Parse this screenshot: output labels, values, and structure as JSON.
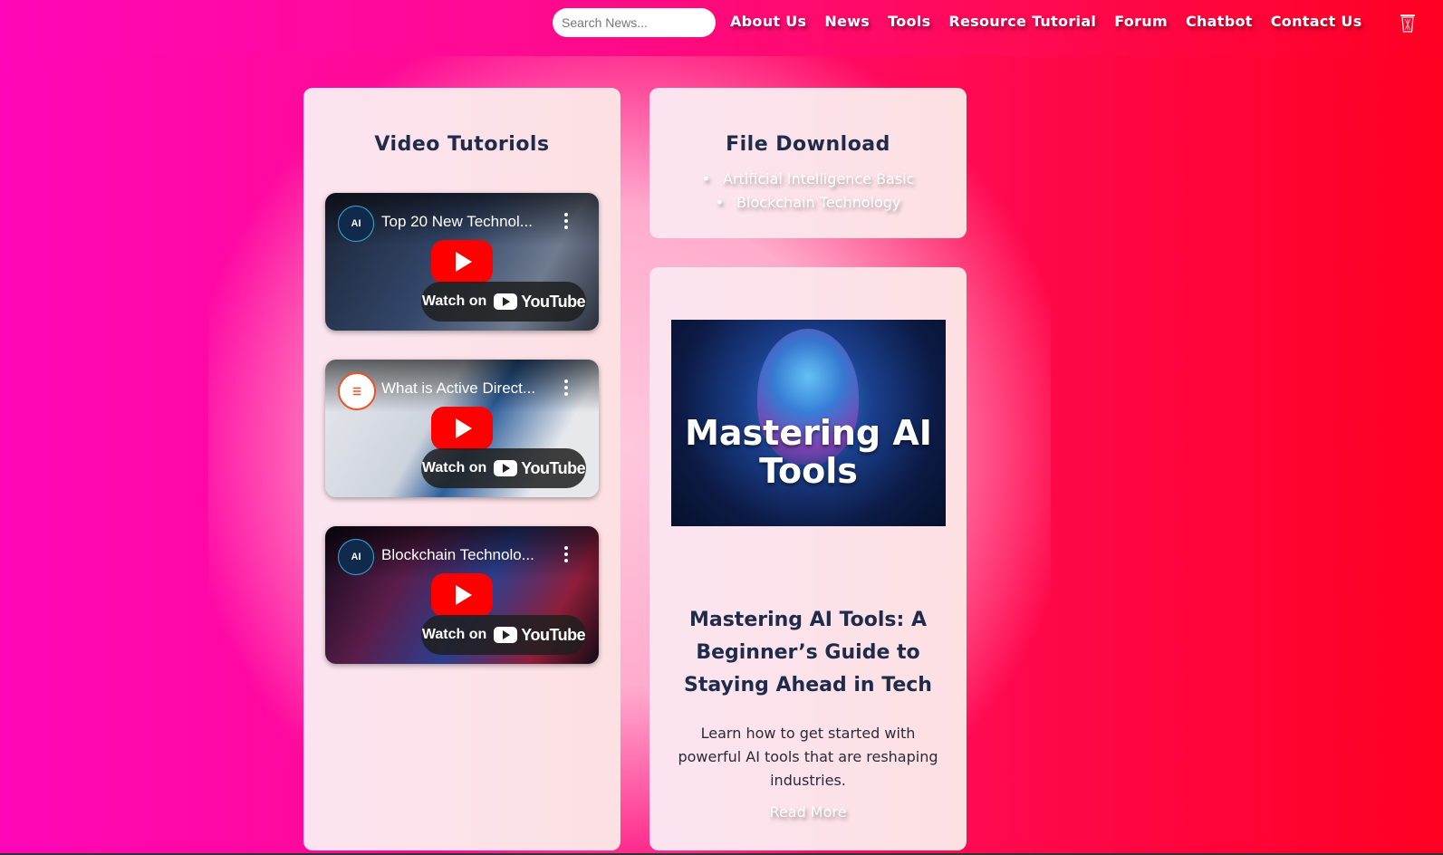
{
  "header": {
    "search_placeholder": "Search News...",
    "nav": [
      "About Us",
      "News",
      "Tools",
      "Resource Tutorial",
      "Forum",
      "Chatbot",
      "Contact Us"
    ],
    "trash_icon": "trash-icon"
  },
  "video_section": {
    "title": "Video Tutoriols",
    "videos": [
      {
        "title": "Top 20 New Technol...",
        "channel_avatar": "AI",
        "watch_label": "Watch on",
        "platform": "YouTube"
      },
      {
        "title": "What is Active Direct...",
        "channel_avatar": "server-icon",
        "watch_label": "Watch on",
        "platform": "YouTube"
      },
      {
        "title": "Blockchain Technolo...",
        "channel_avatar": "AI",
        "watch_label": "Watch on",
        "platform": "YouTube"
      }
    ]
  },
  "file_section": {
    "title": "File Download",
    "files": [
      "Artificial Intelligence Basic",
      "Blockchain Technology"
    ]
  },
  "blog": {
    "image_text": "Mastering AI Tools",
    "title": "Mastering AI Tools: A Beginner’s Guide to Staying Ahead in Tech",
    "description": "Learn how to get started with powerful AI tools that are reshaping industries.",
    "link_label": "Read More"
  },
  "colors": {
    "bg_left": "#ff07b8",
    "bg_right": "#ff0022",
    "card_bg": "#fde0e8",
    "heading": "#1e2b4a",
    "youtube_red": "#ff0000"
  }
}
